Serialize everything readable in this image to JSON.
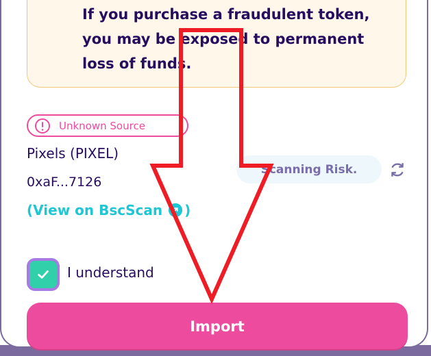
{
  "warning": {
    "text": "If you purchase a fraudulent token, you may be exposed to permanent loss of funds."
  },
  "token": {
    "source_badge": "Unknown Source",
    "name": "Pixels  (PIXEL)",
    "address": "0xaF...7126",
    "view_link": "(View on BscScan",
    "view_link_close": ")"
  },
  "risk": {
    "status": "Scanning Risk."
  },
  "confirm": {
    "checkbox_checked": true,
    "label": "I understand"
  },
  "actions": {
    "import_label": "Import"
  },
  "colors": {
    "primary": "#ed4b9e",
    "secondary": "#1fc7d4",
    "text": "#280d5f",
    "success": "#31d0aa",
    "warning_bg": "#fef7ea",
    "annotation_arrow": "#ee1c24"
  },
  "icons": {
    "source_badge": "alert-circle-icon",
    "view_link": "external-link-icon",
    "refresh": "refresh-icon",
    "checkbox": "checkmark-icon",
    "overlay": "down-arrow-annotation"
  }
}
